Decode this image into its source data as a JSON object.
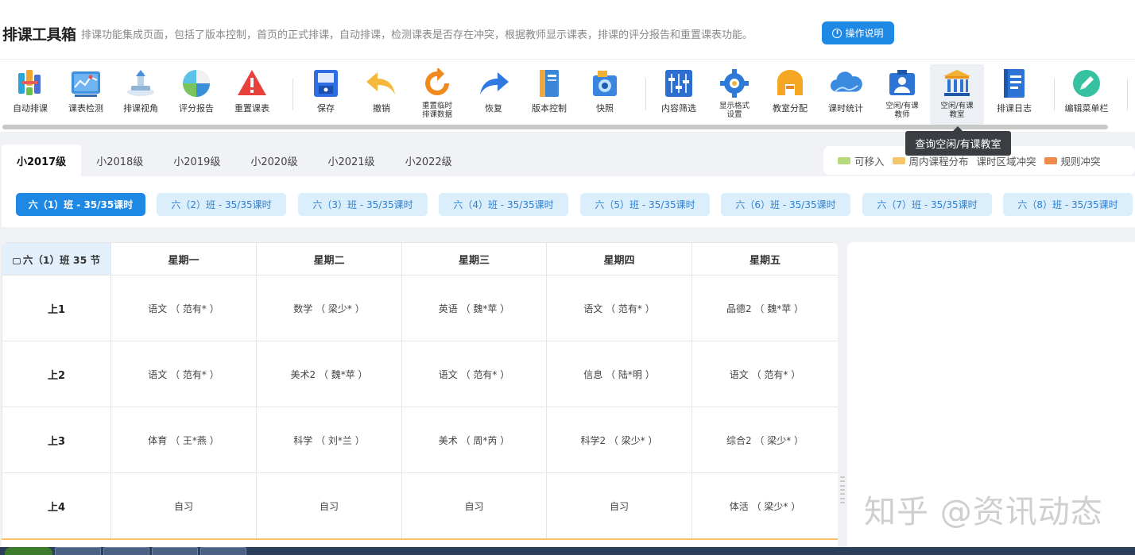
{
  "header": {
    "title": "排课工具箱",
    "description": "排课功能集成页面，包括了版本控制，首页的正式排课，自动排课，检测课表是否存在冲突，根据教师显示课表，排课的评分报告和重置课表功能。",
    "help_label": "操作说明",
    "help_icon_glyph": "i"
  },
  "toolbar": {
    "items": [
      {
        "label": "自动排课",
        "icon": "auto-schedule-icon"
      },
      {
        "label": "课表检测",
        "icon": "chart-check-icon"
      },
      {
        "label": "排课视角",
        "icon": "perspective-icon"
      },
      {
        "label": "评分报告",
        "icon": "pie-report-icon"
      },
      {
        "label": "重置课表",
        "icon": "warning-icon"
      },
      {
        "label": "保存",
        "icon": "save-icon"
      },
      {
        "label": "撤销",
        "icon": "undo-icon"
      },
      {
        "label": "重置临时\n排课数据",
        "icon": "refresh-icon"
      },
      {
        "label": "恢复",
        "icon": "redo-icon"
      },
      {
        "label": "版本控制",
        "icon": "book-icon"
      },
      {
        "label": "快照",
        "icon": "camera-icon"
      },
      {
        "label": "内容筛选",
        "icon": "filter-icon"
      },
      {
        "label": "显示格式\n设置",
        "icon": "gear-icon"
      },
      {
        "label": "教室分配",
        "icon": "classroom-icon"
      },
      {
        "label": "课时统计",
        "icon": "cloud-icon"
      },
      {
        "label": "空闲/有课\n教师",
        "icon": "teacher-icon"
      },
      {
        "label": "空闲/有课\n教室",
        "icon": "building-icon"
      },
      {
        "label": "排课日志",
        "icon": "log-icon"
      },
      {
        "label": "编辑菜单栏",
        "icon": "pencil-icon"
      }
    ],
    "tooltip": "查询空闲/有课教室"
  },
  "grades": {
    "tabs": [
      "小2017级",
      "小2018级",
      "小2019级",
      "小2020级",
      "小2021级",
      "小2022级"
    ],
    "active": 0
  },
  "legend": [
    {
      "label": "可移入",
      "color": "#b5d97b"
    },
    {
      "label": "周内课程分布",
      "color": "#f5c56a"
    },
    {
      "label": "课时区域冲突",
      "color": ""
    },
    {
      "label": "规则冲突",
      "color": "#f08a4b"
    }
  ],
  "classes": {
    "pills": [
      "六（1）班 - 35/35课时",
      "六（2）班 - 35/35课时",
      "六（3）班 - 35/35课时",
      "六（4）班 - 35/35课时",
      "六（5）班 - 35/35课时",
      "六（6）班 - 35/35课时",
      "六（7）班 - 35/35课时",
      "六（8）班 - 35/35课时"
    ],
    "active": 0
  },
  "timetable": {
    "corner": "六（1）班 35 节",
    "days": [
      "星期一",
      "星期二",
      "星期三",
      "星期四",
      "星期五"
    ],
    "rows": [
      {
        "period": "上1",
        "cells": [
          "语文 （ 范有* ）",
          "数学 （ 梁少* ）",
          "英语 （ 魏*苹 ）",
          "语文 （ 范有* ）",
          "品德2 （ 魏*苹 ）"
        ]
      },
      {
        "period": "上2",
        "cells": [
          "语文 （ 范有* ）",
          "美术2 （ 魏*苹 ）",
          "语文 （ 范有* ）",
          "信息 （ 陆*明 ）",
          "语文 （ 范有* ）"
        ]
      },
      {
        "period": "上3",
        "cells": [
          "体育 （ 王*燕 ）",
          "科学 （ 刘*兰 ）",
          "美术 （ 周*芮 ）",
          "科学2 （ 梁少* ）",
          "综合2 （ 梁少* ）"
        ]
      },
      {
        "period": "上4",
        "cells": [
          "自习",
          "自习",
          "自习",
          "自习",
          "体活 （ 梁少* ）"
        ]
      }
    ]
  },
  "watermark": "知乎 @资讯动态"
}
